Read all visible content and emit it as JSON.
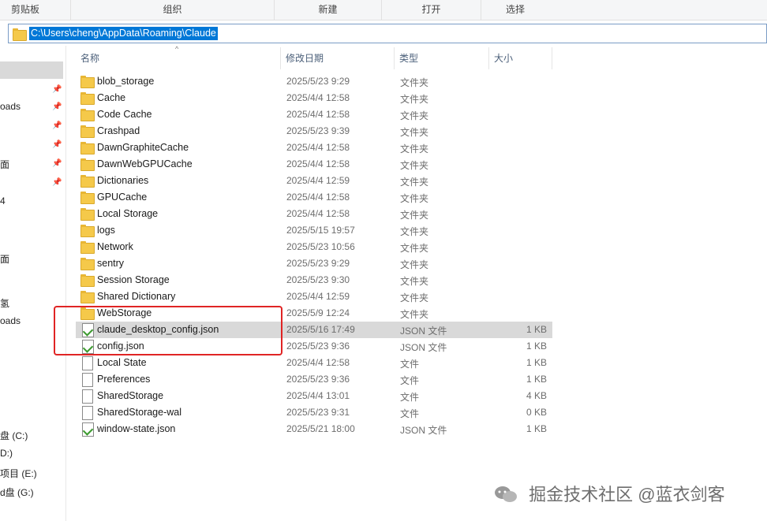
{
  "ribbon": {
    "groups": [
      "剪贴板",
      "组织",
      "新建",
      "打开",
      "选择"
    ]
  },
  "address": {
    "path": "C:\\Users\\cheng\\AppData\\Roaming\\Claude"
  },
  "nav": {
    "items": [
      "oads",
      "面",
      "4",
      "面",
      "氢",
      "oads",
      "盘 (C:)",
      "D:)",
      "项目 (E:)",
      "d盘 (G:)"
    ]
  },
  "columns": {
    "name": "名称",
    "date": "修改日期",
    "type": "类型",
    "size": "大小"
  },
  "files": [
    {
      "name": "blob_storage",
      "date": "2025/5/23 9:29",
      "type": "文件夹",
      "size": "",
      "icon": "folder-icon"
    },
    {
      "name": "Cache",
      "date": "2025/4/4 12:58",
      "type": "文件夹",
      "size": "",
      "icon": "folder-icon"
    },
    {
      "name": "Code Cache",
      "date": "2025/4/4 12:58",
      "type": "文件夹",
      "size": "",
      "icon": "folder-icon"
    },
    {
      "name": "Crashpad",
      "date": "2025/5/23 9:39",
      "type": "文件夹",
      "size": "",
      "icon": "folder-icon"
    },
    {
      "name": "DawnGraphiteCache",
      "date": "2025/4/4 12:58",
      "type": "文件夹",
      "size": "",
      "icon": "folder-icon"
    },
    {
      "name": "DawnWebGPUCache",
      "date": "2025/4/4 12:58",
      "type": "文件夹",
      "size": "",
      "icon": "folder-icon"
    },
    {
      "name": "Dictionaries",
      "date": "2025/4/4 12:59",
      "type": "文件夹",
      "size": "",
      "icon": "folder-icon"
    },
    {
      "name": "GPUCache",
      "date": "2025/4/4 12:58",
      "type": "文件夹",
      "size": "",
      "icon": "folder-icon"
    },
    {
      "name": "Local Storage",
      "date": "2025/4/4 12:58",
      "type": "文件夹",
      "size": "",
      "icon": "folder-icon"
    },
    {
      "name": "logs",
      "date": "2025/5/15 19:57",
      "type": "文件夹",
      "size": "",
      "icon": "folder-icon"
    },
    {
      "name": "Network",
      "date": "2025/5/23 10:56",
      "type": "文件夹",
      "size": "",
      "icon": "folder-icon"
    },
    {
      "name": "sentry",
      "date": "2025/5/23 9:29",
      "type": "文件夹",
      "size": "",
      "icon": "folder-icon"
    },
    {
      "name": "Session Storage",
      "date": "2025/5/23 9:30",
      "type": "文件夹",
      "size": "",
      "icon": "folder-icon"
    },
    {
      "name": "Shared Dictionary",
      "date": "2025/4/4 12:59",
      "type": "文件夹",
      "size": "",
      "icon": "folder-icon"
    },
    {
      "name": "WebStorage",
      "date": "2025/5/9 12:24",
      "type": "文件夹",
      "size": "",
      "icon": "folder-icon"
    },
    {
      "name": "claude_desktop_config.json",
      "date": "2025/5/16 17:49",
      "type": "JSON 文件",
      "size": "1 KB",
      "icon": "json-file-icon"
    },
    {
      "name": "config.json",
      "date": "2025/5/23 9:36",
      "type": "JSON 文件",
      "size": "1 KB",
      "icon": "json-file-icon"
    },
    {
      "name": "Local State",
      "date": "2025/4/4 12:58",
      "type": "文件",
      "size": "1 KB",
      "icon": "file-icon"
    },
    {
      "name": "Preferences",
      "date": "2025/5/23 9:36",
      "type": "文件",
      "size": "1 KB",
      "icon": "file-icon"
    },
    {
      "name": "SharedStorage",
      "date": "2025/4/4 13:01",
      "type": "文件",
      "size": "4 KB",
      "icon": "file-icon"
    },
    {
      "name": "SharedStorage-wal",
      "date": "2025/5/23 9:31",
      "type": "文件",
      "size": "0 KB",
      "icon": "file-icon"
    },
    {
      "name": "window-state.json",
      "date": "2025/5/21 18:00",
      "type": "JSON 文件",
      "size": "1 KB",
      "icon": "json-file-icon"
    }
  ],
  "selected_file": "claude_desktop_config.json",
  "watermark": {
    "text": "掘金技术社区 @蓝衣剑客"
  },
  "colors": {
    "selection": "#d9d9d9",
    "highlight_box": "#e02424",
    "path_selection": "#0078d7",
    "folder": "#f5c94a"
  }
}
